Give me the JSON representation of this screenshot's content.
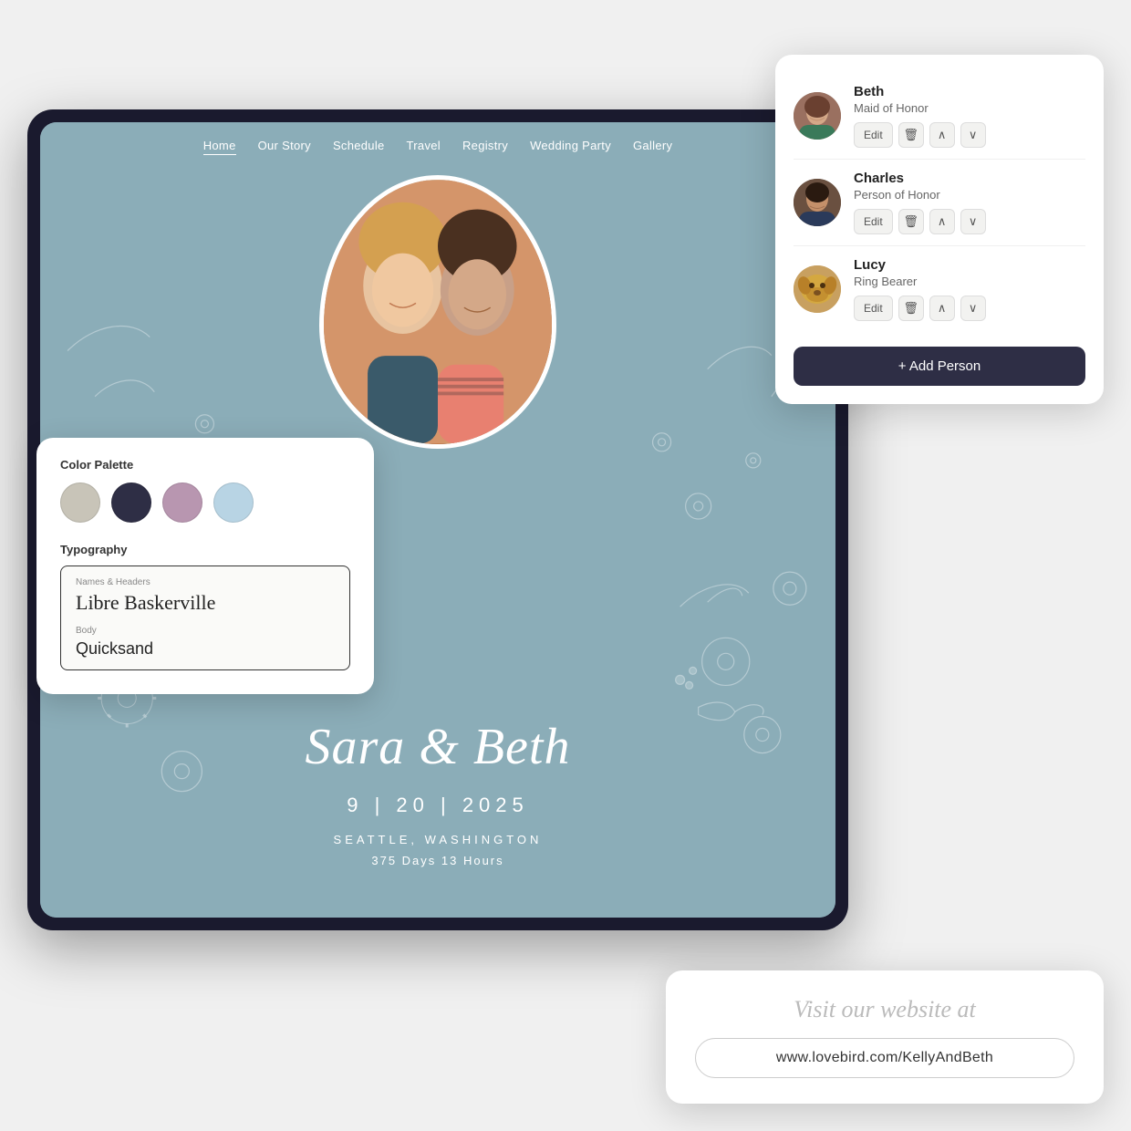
{
  "tablet": {
    "nav": {
      "items": [
        "Home",
        "Our Story",
        "Schedule",
        "Travel",
        "Registry",
        "Wedding Party",
        "Gallery"
      ]
    },
    "wedding": {
      "names": "Sara & Beth",
      "date": "9 | 20 | 2025",
      "location": "SEATTLE, WASHINGTON",
      "countdown": "375 Days  13 Hours"
    }
  },
  "colorPaletteCard": {
    "title": "Color Palette",
    "swatches": [
      {
        "color": "#c8c4b8",
        "label": "warm gray"
      },
      {
        "color": "#2e2e45",
        "label": "navy"
      },
      {
        "color": "#b896b0",
        "label": "mauve"
      },
      {
        "color": "#b8d4e4",
        "label": "light blue"
      }
    ],
    "typographyTitle": "Typography",
    "namesHeaderLabel": "Names & Headers",
    "headerFont": "Libre Baskerville",
    "bodyLabel": "Body",
    "bodyFont": "Quicksand"
  },
  "weddingPartyCard": {
    "members": [
      {
        "name": "Beth",
        "role": "Maid of Honor",
        "avatarClass": "avatar-beth"
      },
      {
        "name": "Charles",
        "role": "Person of Honor",
        "avatarClass": "avatar-charles"
      },
      {
        "name": "Lucy",
        "role": "Ring Bearer",
        "avatarClass": "avatar-lucy"
      }
    ],
    "editLabel": "Edit",
    "addPersonLabel": "+ Add Person"
  },
  "websiteCard": {
    "visitText": "Visit our website at",
    "url": "www.lovebird.com/KellyAndBeth"
  }
}
